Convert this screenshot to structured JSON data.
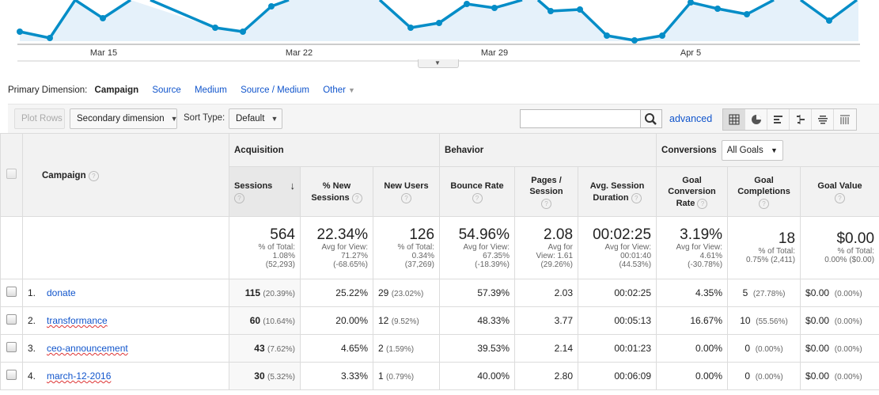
{
  "chart_data": {
    "type": "area",
    "x_labels": [
      "Mar 15",
      "Mar 22",
      "Mar 29",
      "Apr 5"
    ],
    "color": "#058dc7",
    "fill": "#e5f1fa"
  },
  "chart_collapse_label": "⌄",
  "dimension": {
    "label": "Primary Dimension:",
    "active": "Campaign",
    "options": [
      "Source",
      "Medium",
      "Source / Medium",
      "Other"
    ]
  },
  "toolbar": {
    "plot_rows": "Plot Rows",
    "secondary": "Secondary dimension",
    "sort_label": "Sort Type:",
    "sort_value": "Default",
    "search_value": "",
    "advanced": "advanced"
  },
  "table": {
    "campaign_header": "Campaign",
    "groups": {
      "acquisition": "Acquisition",
      "behavior": "Behavior",
      "conversions": "Conversions",
      "goals_select": "All Goals"
    },
    "columns": [
      "Sessions",
      "% New Sessions",
      "New Users",
      "Bounce Rate",
      "Pages / Session",
      "Avg. Session Duration",
      "Goal Conversion Rate",
      "Goal Completions",
      "Goal Value"
    ],
    "totals": [
      {
        "value": "564",
        "l1": "% of Total:",
        "l2": "1.08%",
        "l3": "(52,293)"
      },
      {
        "value": "22.34%",
        "l1": "Avg for View:",
        "l2": "71.27%",
        "l3": "(-68.65%)"
      },
      {
        "value": "126",
        "l1": "% of Total:",
        "l2": "0.34%",
        "l3": "(37,269)"
      },
      {
        "value": "54.96%",
        "l1": "Avg for View:",
        "l2": "67.35%",
        "l3": "(-18.39%)"
      },
      {
        "value": "2.08",
        "l1": "Avg for",
        "l2": "View: 1.61",
        "l3": "(29.26%)"
      },
      {
        "value": "00:02:25",
        "l1": "Avg for View:",
        "l2": "00:01:40",
        "l3": "(44.53%)"
      },
      {
        "value": "3.19%",
        "l1": "Avg for View:",
        "l2": "4.61%",
        "l3": "(-30.78%)"
      },
      {
        "value": "18",
        "l1": "% of Total:",
        "l2": "0.75% (2,411)",
        "l3": ""
      },
      {
        "value": "$0.00",
        "l1": "% of Total:",
        "l2": "0.00% ($0.00)",
        "l3": ""
      }
    ],
    "rows": [
      {
        "num": "1.",
        "name": "donate",
        "sessions": "115",
        "sessions_pct": "(20.39%)",
        "new_sessions": "25.22%",
        "new_users": "29",
        "new_users_pct": "(23.02%)",
        "bounce": "57.39%",
        "pages": "2.03",
        "duration": "00:02:25",
        "conv": "4.35%",
        "completions": "5",
        "completions_pct": "(27.78%)",
        "value": "$0.00",
        "value_pct": "(0.00%)"
      },
      {
        "num": "2.",
        "name": "transformance",
        "sessions": "60",
        "sessions_pct": "(10.64%)",
        "new_sessions": "20.00%",
        "new_users": "12",
        "new_users_pct": "(9.52%)",
        "bounce": "48.33%",
        "pages": "3.77",
        "duration": "00:05:13",
        "conv": "16.67%",
        "completions": "10",
        "completions_pct": "(55.56%)",
        "value": "$0.00",
        "value_pct": "(0.00%)"
      },
      {
        "num": "3.",
        "name": "ceo-announcement",
        "sessions": "43",
        "sessions_pct": "(7.62%)",
        "new_sessions": "4.65%",
        "new_users": "2",
        "new_users_pct": "(1.59%)",
        "bounce": "39.53%",
        "pages": "2.14",
        "duration": "00:01:23",
        "conv": "0.00%",
        "completions": "0",
        "completions_pct": "(0.00%)",
        "value": "$0.00",
        "value_pct": "(0.00%)"
      },
      {
        "num": "4.",
        "name": "march-12-2016",
        "sessions": "30",
        "sessions_pct": "(5.32%)",
        "new_sessions": "3.33%",
        "new_users": "1",
        "new_users_pct": "(0.79%)",
        "bounce": "40.00%",
        "pages": "2.80",
        "duration": "00:06:09",
        "conv": "0.00%",
        "completions": "0",
        "completions_pct": "(0.00%)",
        "value": "$0.00",
        "value_pct": "(0.00%)"
      }
    ]
  }
}
